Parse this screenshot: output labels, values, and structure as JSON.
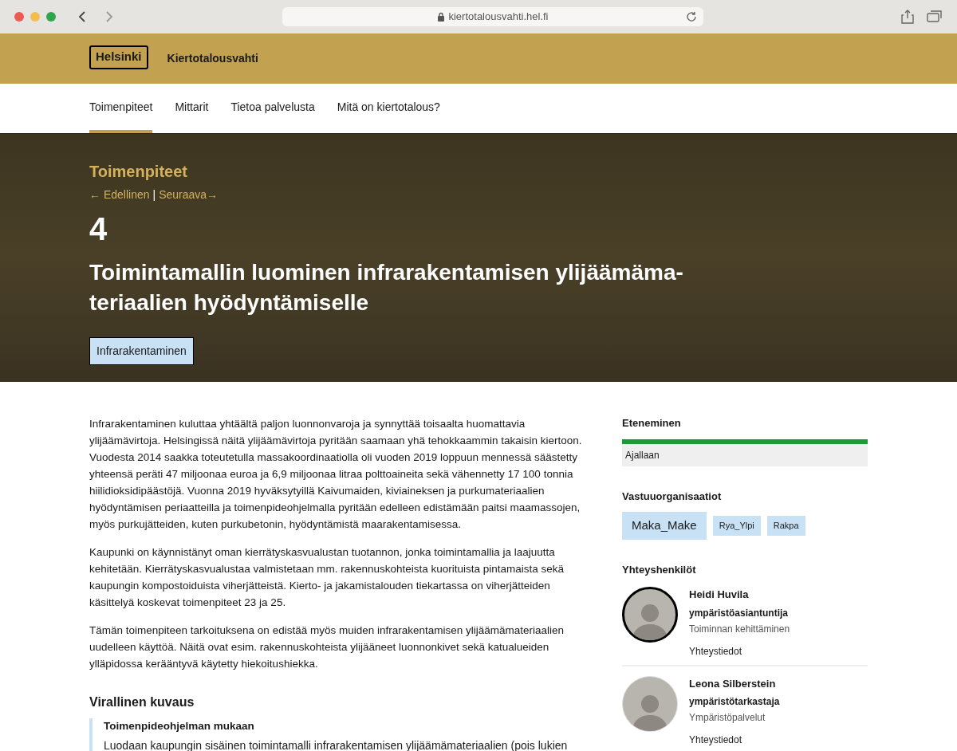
{
  "browser": {
    "url": "kiertotalousvahti.hel.fi"
  },
  "header": {
    "logo": "Helsinki",
    "site_name": "Kiertotalousvahti"
  },
  "nav": [
    {
      "label": "Toimenpiteet",
      "selected": true
    },
    {
      "label": "Mittarit",
      "selected": false
    },
    {
      "label": "Tietoa palvelusta",
      "selected": false
    },
    {
      "label": "Mitä on kiertotalous?",
      "selected": false
    }
  ],
  "hero": {
    "section": "Toimenpiteet",
    "prev": "← Edellinen",
    "separator": "|",
    "next": "Seuraava→",
    "number": "4",
    "title_lines": [
      "Toimintamallin luominen infrarakentamisen ylijäämäma-",
      "teriaalien hyödyntämiselle"
    ],
    "tag": "Infrarakentaminen"
  },
  "paragraphs": [
    "Infrarakentaminen kuluttaa yhtäältä paljon luonnonvaroja ja synnyttää toisaalta huomattavia ylijäämävirtoja. Helsingissä näitä ylijäämävirtoja pyritään saamaan yhä tehokkaammin takaisin kiertoon. Vuodesta 2014 saakka toteutetulla massakoordinaatiolla oli vuoden 2019 loppuun mennessä säästetty yhteensä peräti 47 miljoonaa euroa ja 6,9 miljoonaa litraa polttoaineita sekä vähennetty 17 100 tonnia hiilidioksidipäästöjä. Vuonna 2019 hyväksytyillä Kaivumaiden, kiviaineksen ja purkumateriaalien hyödyntämisen periaatteilla ja toimenpideohjelmalla pyritään edelleen edistämään paitsi maamassojen, myös purkujätteiden, kuten purkubetonin, hyödyntämistä maarakentamisessa.",
    "Kaupunki on käynnistänyt oman kierrätyskasvualustan tuotannon, jonka toimintamallia ja laajuutta kehitetään. Kierrätyskasvualustaa valmistetaan mm. rakennuskohteista kuorituista pintamaista sekä kaupungin kompostoiduista viherjätteistä. Kierto- ja jakamistalouden tiekartassa on viherjätteiden käsittelyä koskevat toimenpiteet 23 ja 25.",
    "Tämän toimenpiteen tarkoituksena on edistää myös muiden infrarakentamisen ylijäämämateriaalien uudelleen käyttöä. Näitä ovat esim. rakennuskohteista ylijääneet luonnonkivet sekä katualueiden ylläpidossa kerääntyvä käytetty hiekoitushiekka."
  ],
  "official": {
    "heading": "Virallinen kuvaus",
    "quote_title": "Toimenpideohjelman mukaan",
    "quote_text": "Luodaan kaupungin sisäinen toimintamalli infrarakentamisen ylijäämämateriaalien (pois lukien"
  },
  "progress": {
    "heading": "Eteneminen",
    "level": 1,
    "color": "#1a9a3c",
    "status": "Ajallaan"
  },
  "organizations": {
    "heading": "Vastuuorganisaatiot",
    "items": [
      {
        "label": "Maka_Make",
        "kind": "large"
      },
      {
        "label": "Rya_Ylpi",
        "kind": "small"
      },
      {
        "label": "Rakpa",
        "kind": "small"
      }
    ]
  },
  "contacts": {
    "heading": "Yhteyshenkilöt",
    "items": [
      {
        "name": "Heidi Huvila",
        "title": "ympäristöasiantuntija",
        "unit": "Toiminnan kehittäminen",
        "link": "Yhteystiedot",
        "highlighted": true
      },
      {
        "name": "Leona Silberstein",
        "title": "ympäristötarkastaja",
        "unit": "Ympäristöpalvelut",
        "link": "Yhteystiedot",
        "highlighted": false
      }
    ]
  }
}
